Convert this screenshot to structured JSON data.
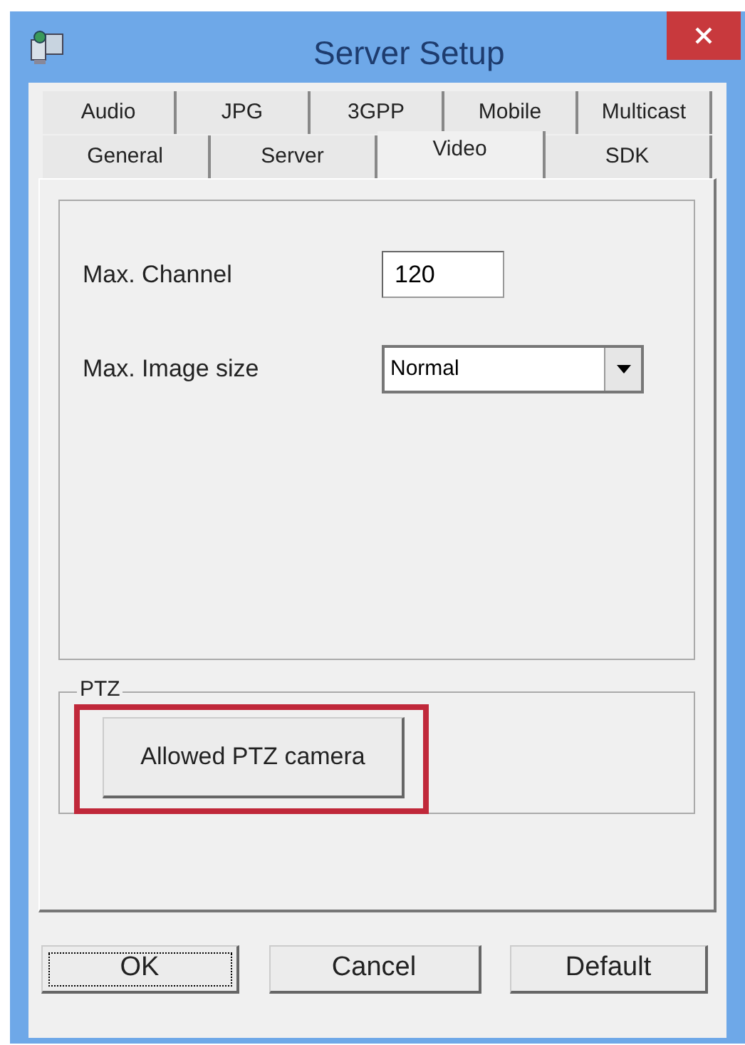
{
  "window": {
    "title": "Server Setup"
  },
  "tab_rows": [
    [
      {
        "label": "Audio",
        "selected": false
      },
      {
        "label": "JPG",
        "selected": false
      },
      {
        "label": "3GPP",
        "selected": false
      },
      {
        "label": "Mobile",
        "selected": false
      },
      {
        "label": "Multicast",
        "selected": false
      }
    ],
    [
      {
        "label": "General",
        "selected": false
      },
      {
        "label": "Server",
        "selected": false
      },
      {
        "label": "Video",
        "selected": true
      },
      {
        "label": "SDK",
        "selected": false
      }
    ]
  ],
  "fields": [
    {
      "kind": "text",
      "label": "Max. Channel",
      "value": "120"
    },
    {
      "kind": "select",
      "label": "Max. Image size",
      "value": "Normal"
    }
  ],
  "ptz": {
    "title": "PTZ",
    "button": "Allowed PTZ camera",
    "highlighted": true
  },
  "buttons": [
    {
      "label": "OK",
      "focused": true
    },
    {
      "label": "Cancel",
      "focused": false
    },
    {
      "label": "Default",
      "focused": false
    }
  ]
}
